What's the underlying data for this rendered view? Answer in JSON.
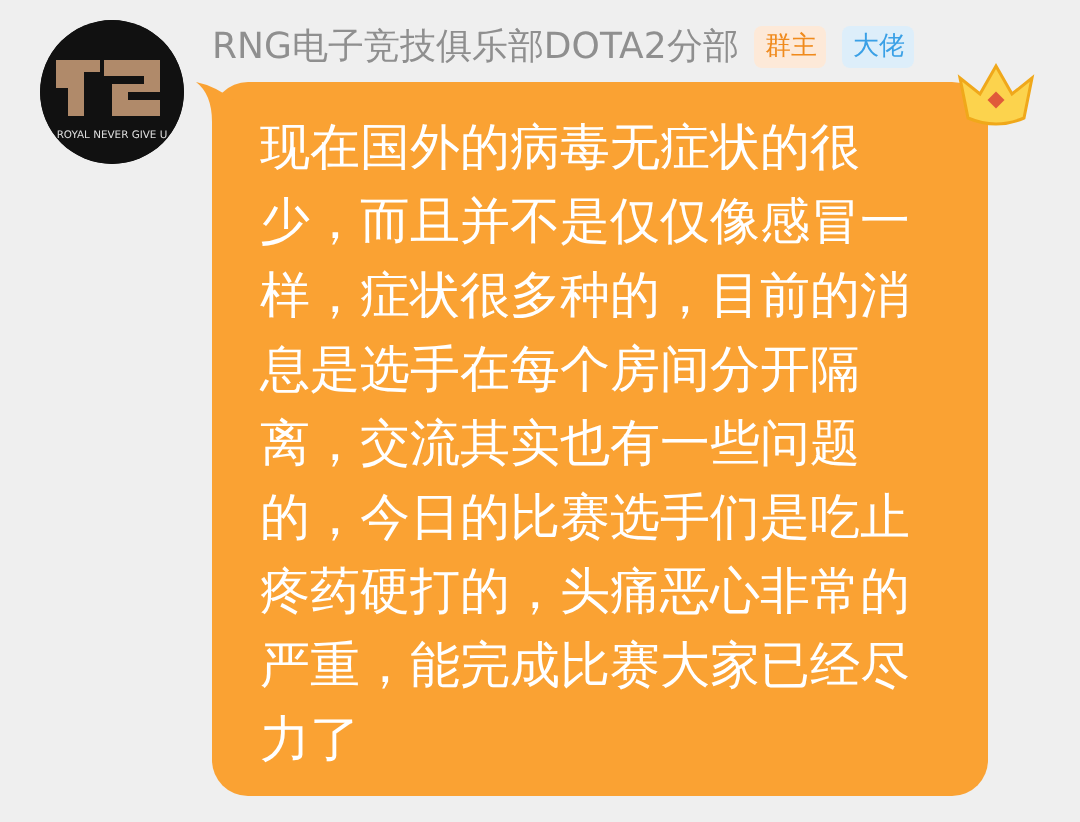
{
  "sender": {
    "name": "RNG电子竞技俱乐部DOTA2分部",
    "avatar_caption": "ROYAL NEVER GIVE U"
  },
  "badges": [
    {
      "label": "群主",
      "kind": "owner"
    },
    {
      "label": "大佬",
      "kind": "title"
    }
  ],
  "message": {
    "text": "现在国外的病毒无症状的很少，而且并不是仅仅像感冒一样，症状很多种的，目前的消息是选手在每个房间分开隔离，交流其实也有一些问题的，今日的比赛选手们是吃止疼药硬打的，头痛恶心非常的严重，能完成比赛大家已经尽力了"
  }
}
